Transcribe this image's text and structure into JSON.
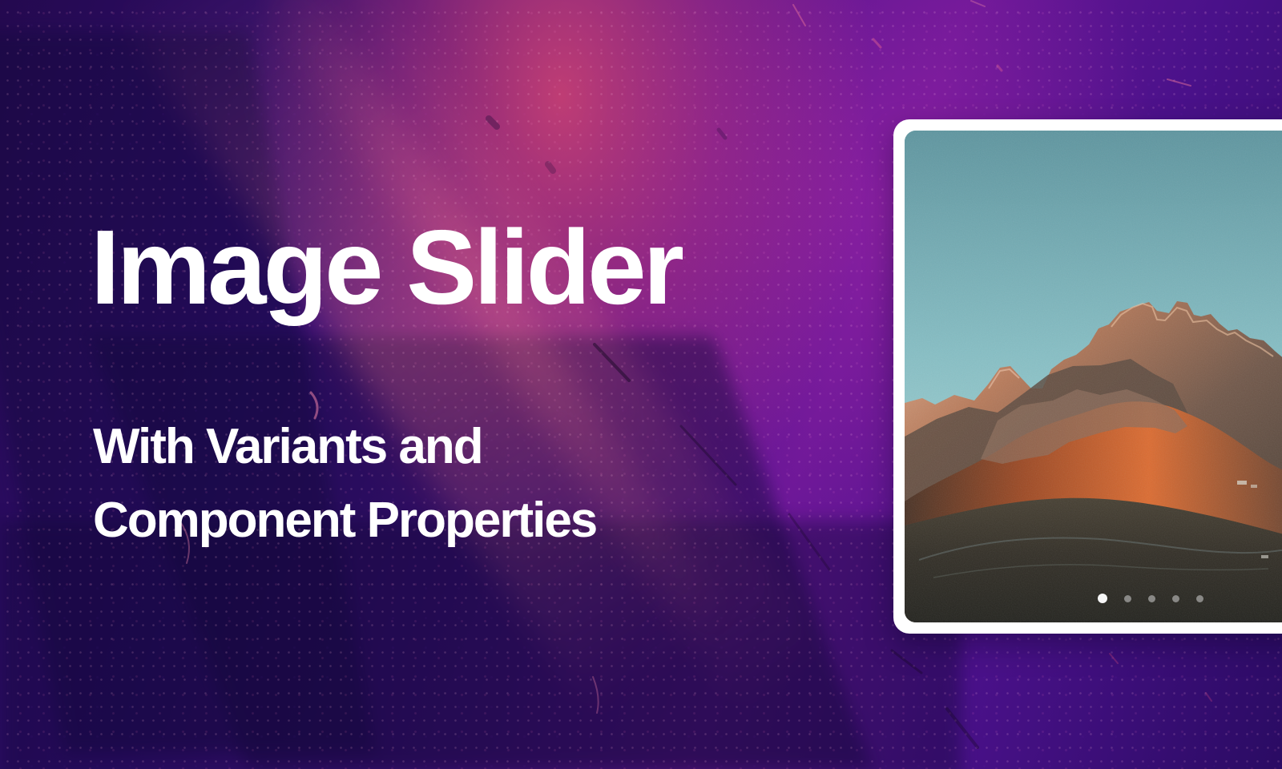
{
  "hero": {
    "title": "Image Slider",
    "subtitle_line_1": "With Variants and",
    "subtitle_line_2": "Component Properties"
  },
  "slider": {
    "slide_count": 5,
    "active_index": 0,
    "image_subject": "mountain landscape at sunset",
    "dots": [
      {
        "state": "active"
      },
      {
        "state": "inactive"
      },
      {
        "state": "inactive"
      },
      {
        "state": "inactive"
      },
      {
        "state": "inactive"
      }
    ]
  },
  "colors": {
    "text": "#ffffff",
    "frame": "#ffffff",
    "background_dark": "#2a0b63",
    "background_pink": "#ef4e70",
    "sky": "#86bfc5",
    "mountain_orange": "#c85d2f"
  }
}
